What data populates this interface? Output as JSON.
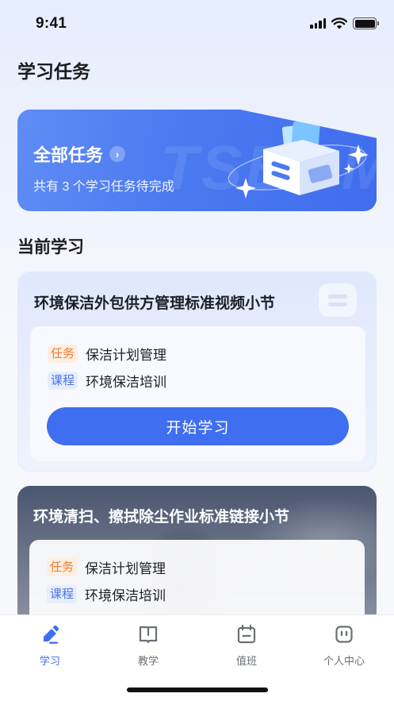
{
  "status_bar": {
    "time": "9:41"
  },
  "page_title": "学习任务",
  "hero": {
    "title": "全部任务",
    "subtitle": "共有 3 个学习任务待完成",
    "watermark": "TSBCM"
  },
  "section_title": "当前学习",
  "courses": [
    {
      "title": "环境保洁外包供方管理标准视频小节",
      "task_tag": "任务",
      "task_value": "保洁计划管理",
      "course_tag": "课程",
      "course_value": "环境保洁培训",
      "button": "开始学习"
    },
    {
      "title": "环境清扫、擦拭除尘作业标准链接小节",
      "task_tag": "任务",
      "task_value": "保洁计划管理",
      "course_tag": "课程",
      "course_value": "环境保洁培训"
    }
  ],
  "tabs": [
    {
      "label": "学习",
      "icon": "pencil-icon",
      "active": true
    },
    {
      "label": "教学",
      "icon": "book-icon",
      "active": false
    },
    {
      "label": "值班",
      "icon": "calendar-icon",
      "active": false
    },
    {
      "label": "个人中心",
      "icon": "robot-face-icon",
      "active": false
    }
  ],
  "colors": {
    "accent": "#3f6ef0",
    "task_tag": "#f07b2e",
    "course_tag": "#4a72e8"
  }
}
